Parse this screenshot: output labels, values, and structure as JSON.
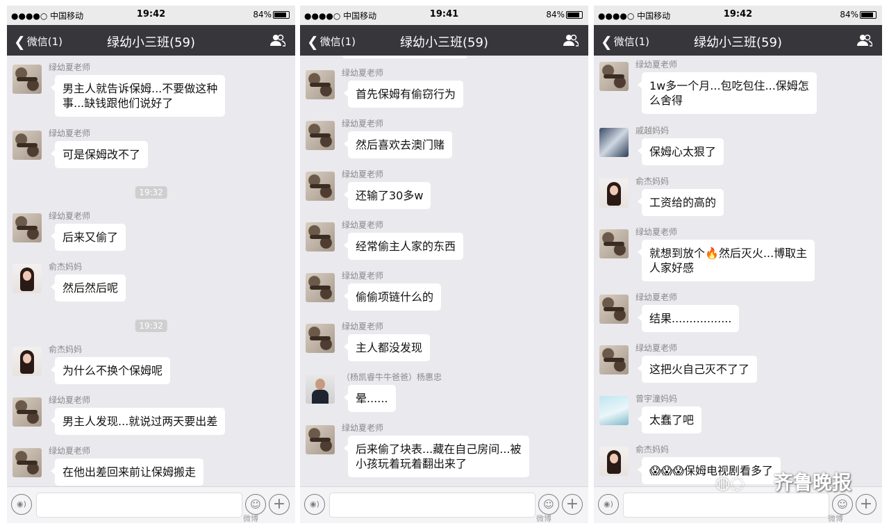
{
  "status": {
    "carrier": "●●●●○ 中国移动",
    "battery": "84%"
  },
  "nav": {
    "back": "微信(1)",
    "title": "绿幼小三班(59)"
  },
  "phones": [
    {
      "time": "19:42",
      "messages": [
        {
          "sender": "绿幼夏老师",
          "text": "男主人就告诉保姆...不要做这种\n事...缺钱跟他们说好了"
        },
        {
          "sender": "绿幼夏老师",
          "text": "可是保姆改不了"
        },
        {
          "timestamp": "19:32"
        },
        {
          "sender": "绿幼夏老师",
          "text": "后来又偷了"
        },
        {
          "sender": "俞杰妈妈",
          "text": "然后然后呢"
        },
        {
          "timestamp": "19:32"
        },
        {
          "sender": "俞杰妈妈",
          "text": "为什么不换个保姆呢"
        },
        {
          "sender": "绿幼夏老师",
          "text": "男主人发现...就说过两天要出差"
        },
        {
          "sender": "绿幼夏老师",
          "text": "在他出差回来前让保姆搬走"
        }
      ]
    },
    {
      "time": "19:41",
      "messages": [
        {
          "sender": "绿幼夏老师",
          "text": "首先保姆有偷窃行为"
        },
        {
          "sender": "绿幼夏老师",
          "text": "然后喜欢去澳门赌"
        },
        {
          "sender": "绿幼夏老师",
          "text": "还输了30多w"
        },
        {
          "sender": "绿幼夏老师",
          "text": "经常偷主人家的东西"
        },
        {
          "sender": "绿幼夏老师",
          "text": "偷偷项链什么的"
        },
        {
          "sender": "绿幼夏老师",
          "text": "主人都没发现"
        },
        {
          "sender": "（杨凯睿牛牛爸爸）杨惠忠",
          "text": "晕......"
        },
        {
          "sender": "绿幼夏老师",
          "text": "后来偷了块表...藏在自己房间...被\n小孩玩着玩着翻出来了"
        }
      ]
    },
    {
      "time": "19:42",
      "messages": [
        {
          "sender": "绿幼夏老师",
          "text": "1w多一个月...包吃包住...保姆怎\n么舍得"
        },
        {
          "sender": "戚越妈妈",
          "text": "保姆心太狠了"
        },
        {
          "sender": "俞杰妈妈",
          "text": "工资给的高的"
        },
        {
          "sender": "绿幼夏老师",
          "text": "就想到放个🔥然后灭火...博取主\n人家好感"
        },
        {
          "sender": "绿幼夏老师",
          "text": "结果................."
        },
        {
          "sender": "绿幼夏老师",
          "text": "这把火自己灭不了了"
        },
        {
          "sender": "曾宇潼妈妈",
          "text": "太蠢了吧"
        },
        {
          "sender": "俞杰妈妈",
          "text": "😱😱😱保姆电视剧看多了"
        }
      ]
    }
  ],
  "watermark": {
    "brand": "齐鲁晚报",
    "weibo": "微博"
  },
  "icons": {
    "back": "chevron-left-icon",
    "group": "group-members-icon",
    "voice": "voice-icon",
    "emoji": "emoji-icon",
    "plus": "plus-icon",
    "wechat": "wechat-logo-icon"
  },
  "colors": {
    "navbar": "#36363b",
    "chat_bg": "#eae9ee",
    "bubble": "#ffffff"
  }
}
